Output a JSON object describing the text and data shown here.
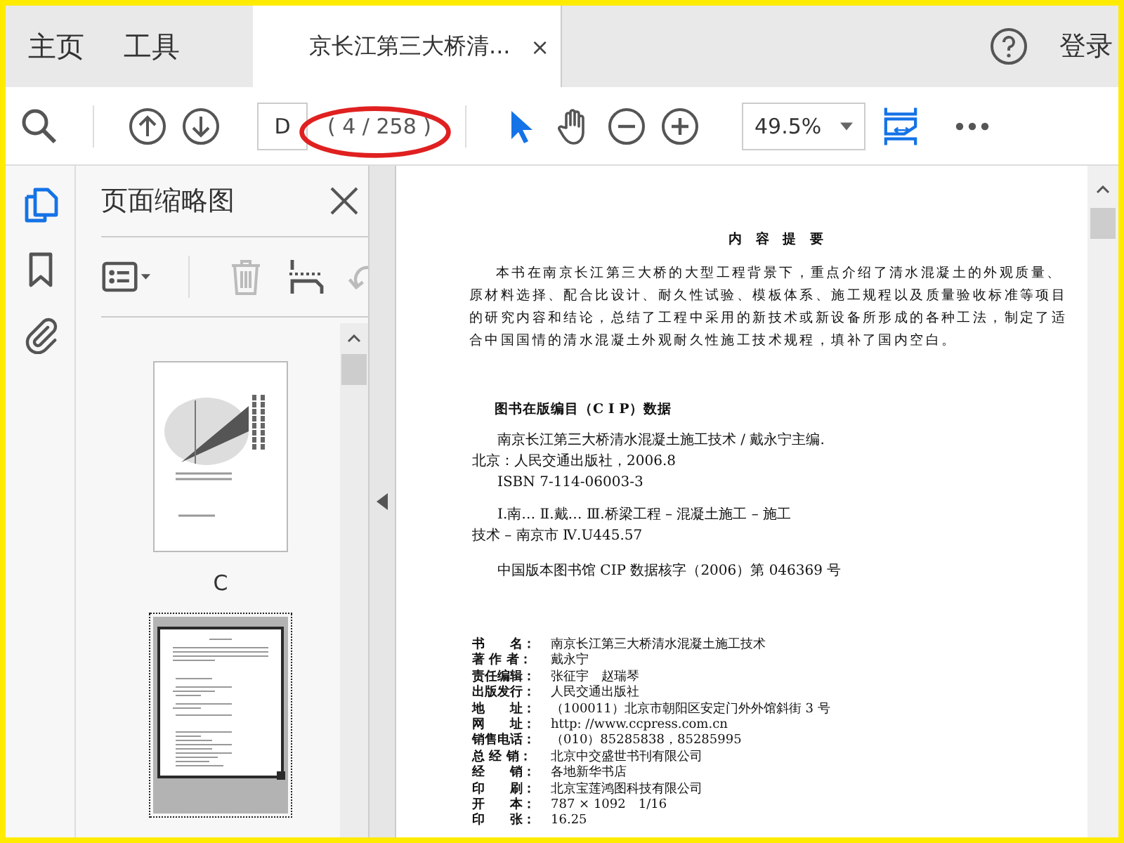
{
  "menu_tabs": [
    {
      "label": "主页"
    },
    {
      "label": "工具"
    }
  ],
  "document_tab": {
    "title": "京长江第三大桥清...",
    "close": "×"
  },
  "account": {
    "login": "登录"
  },
  "toolbar": {
    "page_field": {
      "value": "D"
    },
    "page_count": "( 4 / 258 )",
    "zoom": {
      "value": "49.5%"
    },
    "tools": [
      {
        "kind": "select",
        "selected": true
      },
      {
        "kind": "hand",
        "selected": false
      }
    ]
  },
  "side_rail": [
    {
      "kind": "pages",
      "selected": true
    },
    {
      "kind": "bookmarks",
      "selected": false
    },
    {
      "kind": "attachments",
      "selected": false
    }
  ],
  "thumbnail_panel": {
    "title": "页面缩略图",
    "actions": [
      {
        "kind": "delete",
        "disabled": true
      },
      {
        "kind": "crop",
        "disabled": false
      },
      {
        "kind": "rotate",
        "disabled": true
      }
    ],
    "thumbnails": [
      {
        "kind": "cover",
        "label": "C",
        "selected": false
      },
      {
        "kind": "text",
        "selected": true
      }
    ]
  },
  "document_page": {
    "heading": "内 容 提 要",
    "summary": "本书在南京长江第三大桥的大型工程背景下，重点介绍了清水混凝土的外观质量、原材料选择、配合比设计、耐久性试验、模板体系、施工规程以及质量验收标准等项目的研究内容和结论，总结了工程中采用的新技术或新设备所形成的各种工法，制定了适合中国国情的清水混凝土外观耐久性施工技术规程，填补了国内空白。",
    "cip_title": "图书在版编目（C I P）数据",
    "cip_lines": [
      {
        "text": "南京长江第三大桥清水混凝土施工技术 / 戴永宁主编.",
        "indent": true
      },
      {
        "text": "北京：人民交通出版社，2006.8",
        "indent": false
      },
      {
        "text": "ISBN 7-114-06003-3",
        "indent": true
      }
    ],
    "subject_lines": [
      {
        "text": "Ⅰ.南…  Ⅱ.戴…  Ⅲ.桥梁工程 – 混凝土施工 – 施工",
        "indent": true
      },
      {
        "text": "技术 – 南京市    Ⅳ.U445.57",
        "indent": false
      }
    ],
    "cip_number": "中国版本图书馆 CIP 数据核字（2006）第 046369 号",
    "colophon": [
      {
        "label": "书　　名：",
        "value": "南京长江第三大桥清水混凝土施工技术"
      },
      {
        "label": "著 作 者：",
        "value": "戴永宁"
      },
      {
        "label": "责任编辑：",
        "value": "张征宇　赵瑞琴"
      },
      {
        "label": "出版发行：",
        "value": "人民交通出版社"
      },
      {
        "label": "地　　址：",
        "value": "（100011）北京市朝阳区安定门外外馆斜街 3 号"
      },
      {
        "label": "网　　址：",
        "value": "http: //www.ccpress.com.cn"
      },
      {
        "label": "销售电话：",
        "value": "（010）85285838，85285995"
      },
      {
        "label": "总 经 销：",
        "value": "北京中交盛世书刊有限公司"
      },
      {
        "label": "经　　销：",
        "value": "各地新华书店"
      },
      {
        "label": "印　　刷：",
        "value": "北京宝莲鸿图科技有限公司"
      },
      {
        "label": "开　　本：",
        "value": "787 × 1092　1/16"
      },
      {
        "label": "印　　张：",
        "value": "16.25"
      }
    ]
  }
}
